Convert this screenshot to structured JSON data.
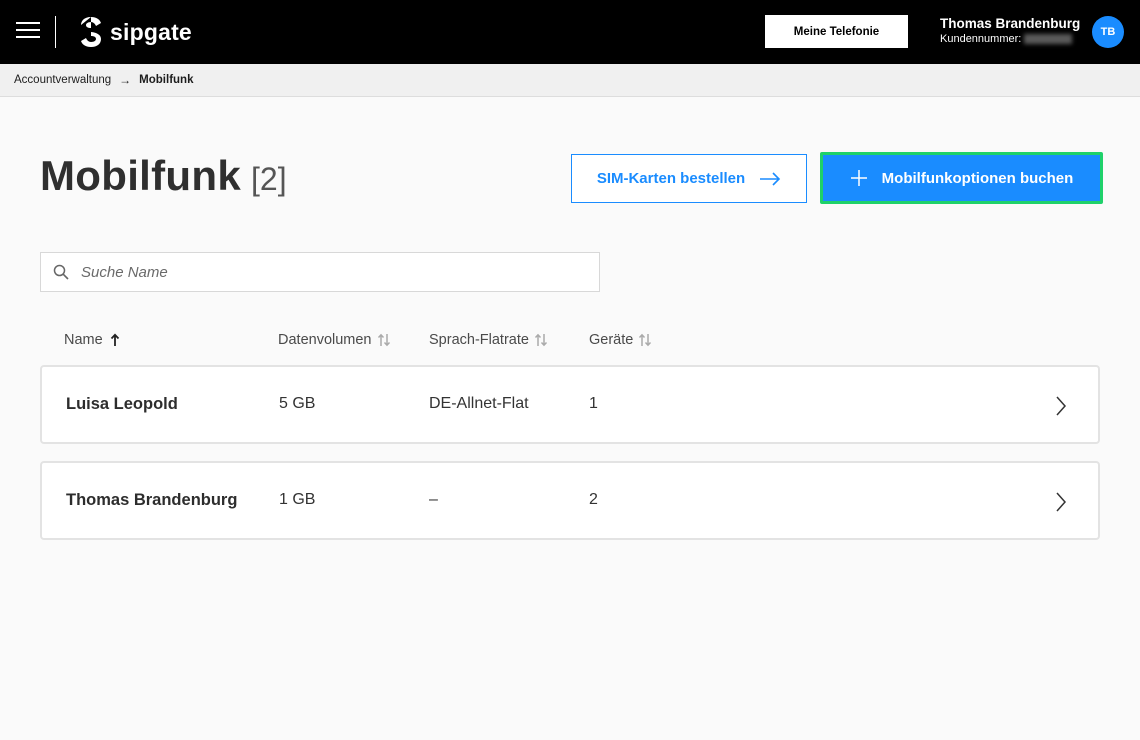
{
  "header": {
    "logo_text": "sipgate",
    "telefonie_button": "Meine Telefonie",
    "user_name": "Thomas Brandenburg",
    "customer_label": "Kundennummer:",
    "avatar_initials": "TB"
  },
  "breadcrumb": {
    "parent": "Accountverwaltung",
    "separator": "→",
    "current": "Mobilfunk"
  },
  "page": {
    "title": "Mobilfunk",
    "count": "[2]",
    "sim_button": "SIM-Karten bestellen",
    "book_button": "Mobilfunkoptionen buchen"
  },
  "search": {
    "placeholder": "Suche Name",
    "value": ""
  },
  "table": {
    "columns": [
      {
        "label": "Name",
        "sort": "ascending"
      },
      {
        "label": "Datenvolumen",
        "sort": "none"
      },
      {
        "label": "Sprach-Flatrate",
        "sort": "none"
      },
      {
        "label": "Geräte",
        "sort": "none"
      }
    ],
    "rows": [
      {
        "name": "Luisa Leopold",
        "data": "5 GB",
        "flat": "DE-Allnet-Flat",
        "devices": "1"
      },
      {
        "name": "Thomas Brandenburg",
        "data": "1 GB",
        "flat": "–",
        "devices": "2"
      }
    ]
  },
  "colors": {
    "accent": "#1a8cff",
    "highlight": "#1fd16a",
    "topbar": "#000000"
  }
}
